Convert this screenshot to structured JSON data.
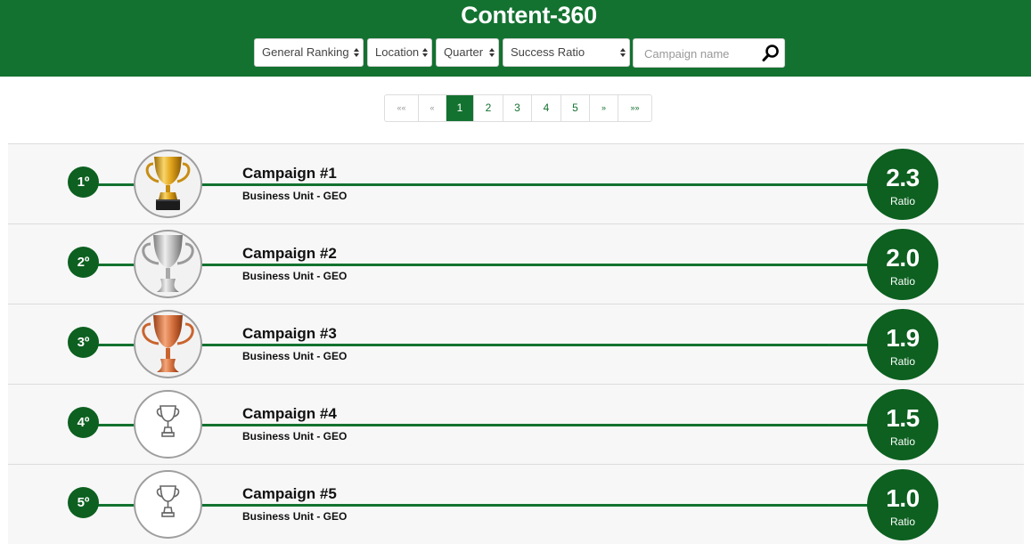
{
  "header": {
    "title": "Content-360",
    "filters": [
      {
        "label": "General Ranking"
      },
      {
        "label": "Location"
      },
      {
        "label": "Quarter"
      },
      {
        "label": "Success Ratio"
      }
    ],
    "search_placeholder": "Campaign name",
    "search_value": ""
  },
  "pagination": {
    "first": "««",
    "prev": "«",
    "pages": [
      "1",
      "2",
      "3",
      "4",
      "5"
    ],
    "active": "1",
    "next": "»",
    "last": "»»"
  },
  "campaigns": [
    {
      "rank": "1º",
      "name": "Campaign #1",
      "unit": "Business Unit - GEO",
      "ratio": "2.3",
      "ratio_label": "Ratio",
      "trophy": "gold-trophy"
    },
    {
      "rank": "2º",
      "name": "Campaign #2",
      "unit": "Business Unit - GEO",
      "ratio": "2.0",
      "ratio_label": "Ratio",
      "trophy": "silver-trophy"
    },
    {
      "rank": "3º",
      "name": "Campaign #3",
      "unit": "Business Unit - GEO",
      "ratio": "1.9",
      "ratio_label": "Ratio",
      "trophy": "bronze-trophy"
    },
    {
      "rank": "4º",
      "name": "Campaign #4",
      "unit": "Business Unit - GEO",
      "ratio": "1.5",
      "ratio_label": "Ratio",
      "trophy": "outline-trophy"
    },
    {
      "rank": "5º",
      "name": "Campaign #5",
      "unit": "Business Unit - GEO",
      "ratio": "1.0",
      "ratio_label": "Ratio",
      "trophy": "outline-trophy"
    }
  ],
  "colors": {
    "brand_green": "#137230",
    "dark_green": "#0d6020",
    "row_bg": "#f7f7f7"
  }
}
